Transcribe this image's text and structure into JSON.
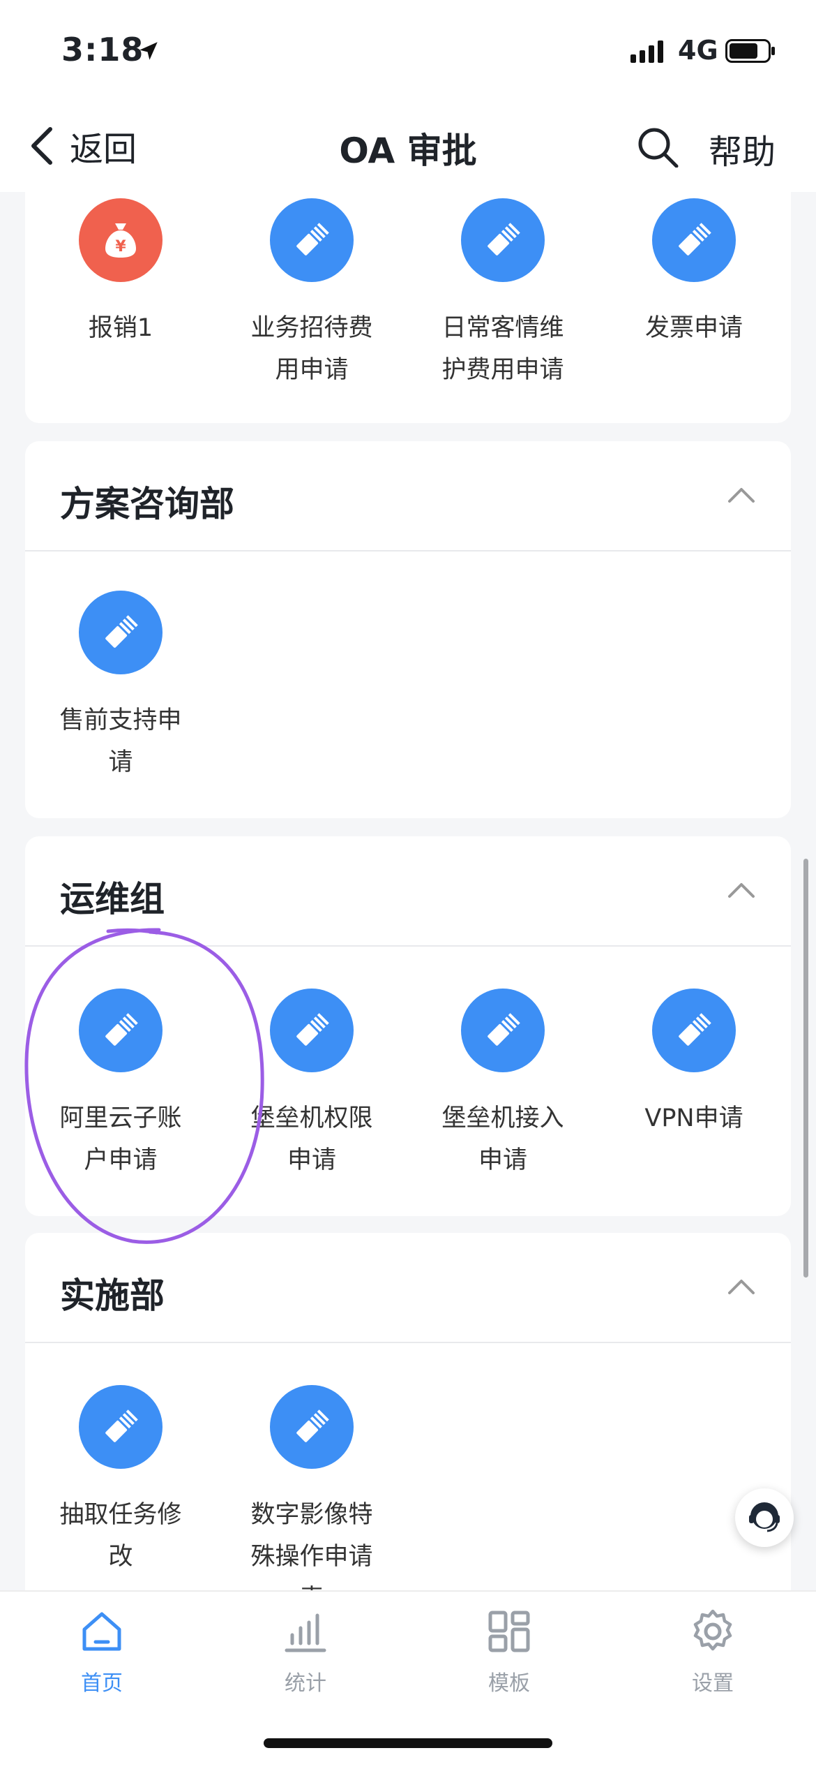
{
  "status": {
    "time": "3:18",
    "network": "4G"
  },
  "nav": {
    "back_label": "返回",
    "title": "OA 审批",
    "help_label": "帮助"
  },
  "sections": [
    {
      "title": "",
      "items": [
        {
          "label": "报销1",
          "icon": "money-bag-icon",
          "color": "#f0614e"
        },
        {
          "label": "业务招待费用申请",
          "icon": "form-icon",
          "color": "#3d8ff5"
        },
        {
          "label": "日常客情维护费用申请",
          "icon": "form-icon",
          "color": "#3d8ff5"
        },
        {
          "label": "发票申请",
          "icon": "form-icon",
          "color": "#3d8ff5"
        }
      ]
    },
    {
      "title": "方案咨询部",
      "items": [
        {
          "label": "售前支持申请",
          "icon": "form-icon",
          "color": "#3d8ff5"
        }
      ]
    },
    {
      "title": "运维组",
      "items": [
        {
          "label": "阿里云子账户申请",
          "icon": "form-icon",
          "color": "#3d8ff5"
        },
        {
          "label": "堡垒机权限申请",
          "icon": "form-icon",
          "color": "#3d8ff5"
        },
        {
          "label": "堡垒机接入申请",
          "icon": "form-icon",
          "color": "#3d8ff5"
        },
        {
          "label": "VPN申请",
          "icon": "form-icon",
          "color": "#3d8ff5"
        }
      ]
    },
    {
      "title": "实施部",
      "items": [
        {
          "label": "抽取任务修改",
          "icon": "form-icon",
          "color": "#3d8ff5"
        },
        {
          "label": "数字影像特殊操作申请表",
          "icon": "form-icon",
          "color": "#3d8ff5"
        }
      ]
    }
  ],
  "tabs": [
    {
      "label": "首页",
      "icon": "home-icon",
      "active": true
    },
    {
      "label": "统计",
      "icon": "chart-icon",
      "active": false
    },
    {
      "label": "模板",
      "icon": "grid-icon",
      "active": false
    },
    {
      "label": "设置",
      "icon": "gear-icon",
      "active": false
    }
  ],
  "colors": {
    "accent": "#3d8ff5",
    "annotation": "#9b5de5"
  }
}
